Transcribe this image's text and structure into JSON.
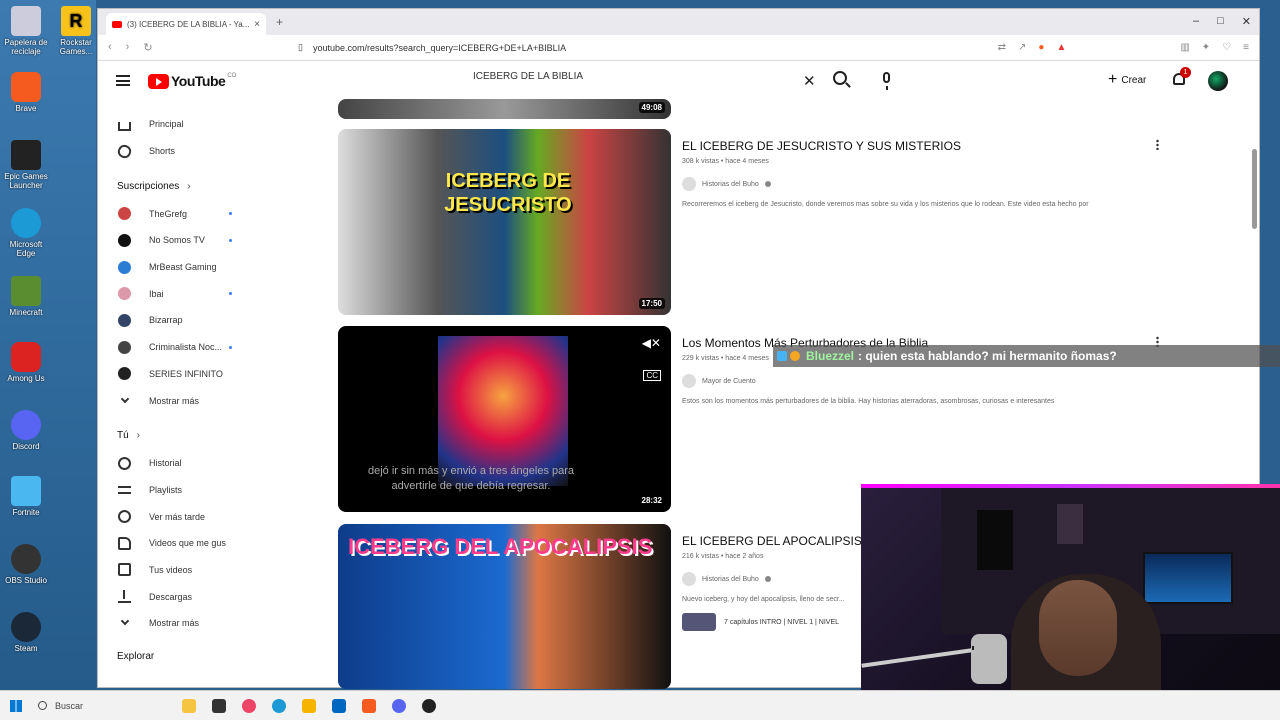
{
  "desktop": {
    "icons": [
      "Papelera de reciclaje",
      "Brave",
      "Epic Games Launcher",
      "Microsoft Edge",
      "Minecraft",
      "Among Us",
      "Discord",
      "Fortnite",
      "OBS Studio",
      "Steam"
    ],
    "icon_top_right": "Rockstar Games..."
  },
  "browser": {
    "tab_title": "(3) ICEBERG DE LA BIBLIA - Ya...",
    "url": "youtube.com/results?search_query=ICEBERG+DE+LA+BIBLIA"
  },
  "youtube": {
    "logo": "YouTube",
    "search_query": "ICEBERG DE LA BIBLIA",
    "create_label": "Crear",
    "notif_count": "1"
  },
  "sidebar": {
    "main": [
      "Principal",
      "Shorts"
    ],
    "subs_title": "Suscripciones",
    "channels": [
      {
        "name": "TheGrefg",
        "color": "#c44"
      },
      {
        "name": "No Somos TV",
        "color": "#111"
      },
      {
        "name": "MrBeast Gaming",
        "color": "#2b7cd3"
      },
      {
        "name": "Ibai",
        "color": "#d9a"
      },
      {
        "name": "Bizarrap",
        "color": "#346"
      },
      {
        "name": "Criminalista Noc...",
        "color": "#444"
      },
      {
        "name": "SERIES INFINITO",
        "color": "#222"
      }
    ],
    "show_more": "Mostrar más",
    "you_title": "Tú",
    "you_items": [
      "Historial",
      "Playlists",
      "Ver más tarde",
      "Videos que me gus",
      "Tus videos",
      "Descargas",
      "Mostrar más"
    ],
    "explore": "Explorar"
  },
  "results": [
    {
      "duration": "49:08"
    },
    {
      "title": "EL ICEBERG DE JESUCRISTO Y SUS MISTERIOS",
      "meta": "308 k vistas • hace 4 meses",
      "channel": "Historias del Buho",
      "desc": "Recorreremos el iceberg de Jesucristo, donde veremos mas sobre su vida y los misterios que lo rodean. Este video esta hecho por",
      "duration": "17:50",
      "thumb_text": "ICEBERG DE JESUCRISTO"
    },
    {
      "title": "Los Momentos Más Perturbadores de la Biblia",
      "meta": "229 k vistas • hace 4 meses",
      "channel": "Mayor de Cuento",
      "desc": "Estos son los momentos más perturbadores de la biblia. Hay historias aterradoras, asombrosas, curiosas e interesantes",
      "duration": "28:32",
      "caption": "dejó ir sin más y envió a tres ángeles para advertirle de que debía regresar."
    },
    {
      "title": "EL ICEBERG DEL APOCALIPSIS EX...",
      "meta": "216 k vistas • hace 2 años",
      "channel": "Historias del Buho",
      "desc": "Nuevo iceberg, y hoy del apocalipsis, lleno de secr...",
      "chapters": "7 capítulos  INTRO | NIVEL 1 | NIVEL",
      "thumb_text": "ICEBERG DEL APOCALIPSIS"
    }
  ],
  "chat": {
    "user": "Bluezzel",
    "message": ": quien esta hablando? mi hermanito ñomas?"
  },
  "taskbar": {
    "search": "Buscar"
  }
}
